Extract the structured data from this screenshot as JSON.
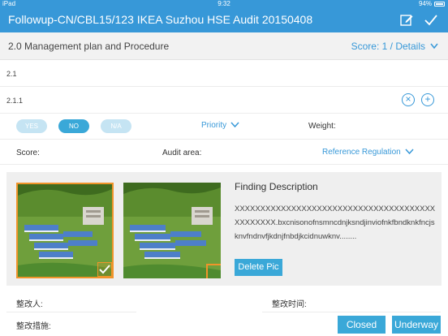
{
  "status_bar": {
    "device": "iPad",
    "time": "9:32",
    "battery": "94%"
  },
  "nav": {
    "title": "Followup-CN/CBL15/123 IKEA Suzhou HSE Audit 20150408",
    "icons": [
      "edit-icon",
      "checkmark-icon"
    ]
  },
  "section": {
    "title": "2.0 Management plan and Procedure",
    "score_link": "Score: 1 / Details"
  },
  "rows": {
    "r1": "2.1",
    "r2": "2.1.1"
  },
  "answers": {
    "yes": "YES",
    "no": "NO",
    "na": "N/A",
    "selected": "NO"
  },
  "fields": {
    "priority": "Priority",
    "weight": "Weight:",
    "score": "Score:",
    "audit_area": "Audit area:",
    "reference": "Reference Regulation"
  },
  "finding": {
    "title": "Finding Description",
    "text": "XXXXXXXXXXXXXXXXXXXXXXXXXXXXXXXXXXXXXXXXXXXXXXX.bxcnisonofnsmncdnjksndjinviofnkfbndknkfncjsknvfndnvfjkdnjfnbdjkcidnuwknv........",
    "delete_label": "Delete Pic"
  },
  "bottom": {
    "rectifier": "整改人:",
    "measures": "整改措施:",
    "time": "整改时间:",
    "closed": "Closed",
    "underway": "Underway"
  },
  "colors": {
    "brand": "#3798d8",
    "selected_border": "#f0942a",
    "pill_on": "#3aa8d8",
    "pill_off": "#c5e4f3"
  }
}
